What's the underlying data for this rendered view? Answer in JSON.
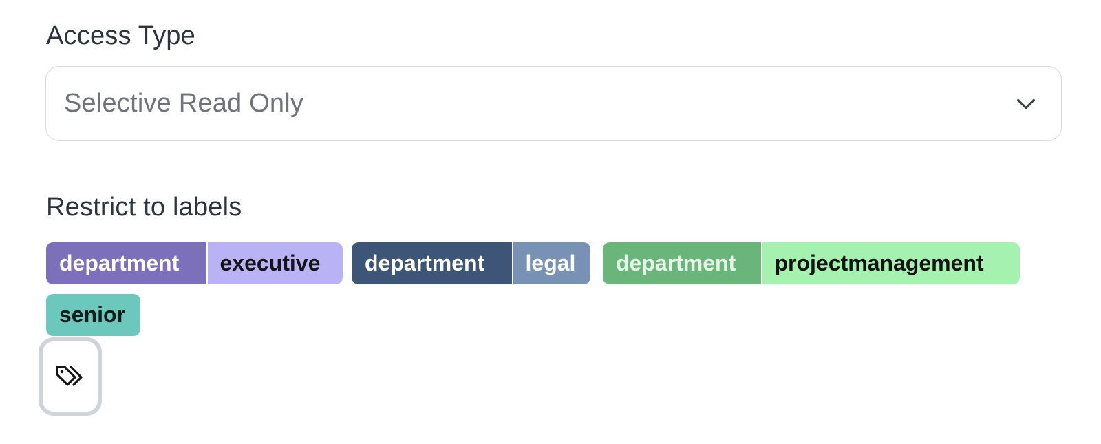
{
  "access_type": {
    "label": "Access Type",
    "selected_value": "Selective Read Only",
    "icon": "chevron-down-icon"
  },
  "restrict_labels": {
    "label": "Restrict to labels",
    "chips": [
      {
        "key": "department",
        "value": "executive",
        "key_color": "#7b70b9",
        "value_color": "#b9b3f6"
      },
      {
        "key": "department",
        "value": "legal",
        "key_color": "#3d5677",
        "value_color": "#7892b6"
      },
      {
        "key": "department",
        "value": "projectmanagement",
        "key_color": "#6ab57a",
        "value_color": "#a5f2b0"
      },
      {
        "value": "senior",
        "value_color": "#6cc8bc"
      }
    ],
    "add_button_icon": "tags-icon"
  }
}
